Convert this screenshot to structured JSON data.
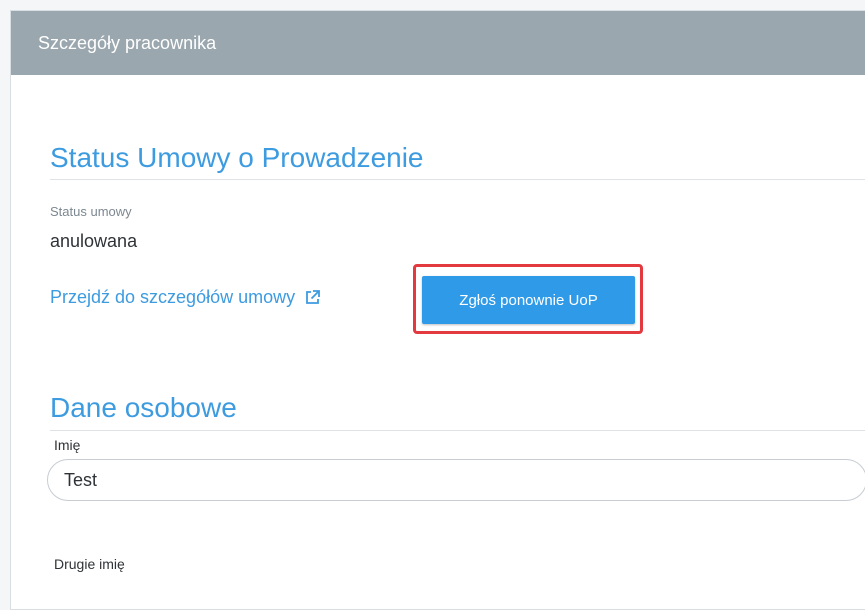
{
  "header": {
    "title": "Szczegóły pracownika"
  },
  "contract_section": {
    "title": "Status Umowy o Prowadzenie",
    "status_label": "Status umowy",
    "status_value": "anulowana",
    "details_link": "Przejdź do szczegółów umowy",
    "resubmit_button": "Zgłoś ponownie UoP"
  },
  "personal_section": {
    "title": "Dane osobowe",
    "first_name_label": "Imię",
    "first_name_value": "Test",
    "second_name_label": "Drugie imię"
  },
  "colors": {
    "header_bg": "#9aa7ae",
    "accent": "#3d9be0",
    "button_bg": "#2f9be8",
    "highlight": "#e23a3f"
  },
  "icons": {
    "details_link_icon": "external-link-icon"
  }
}
